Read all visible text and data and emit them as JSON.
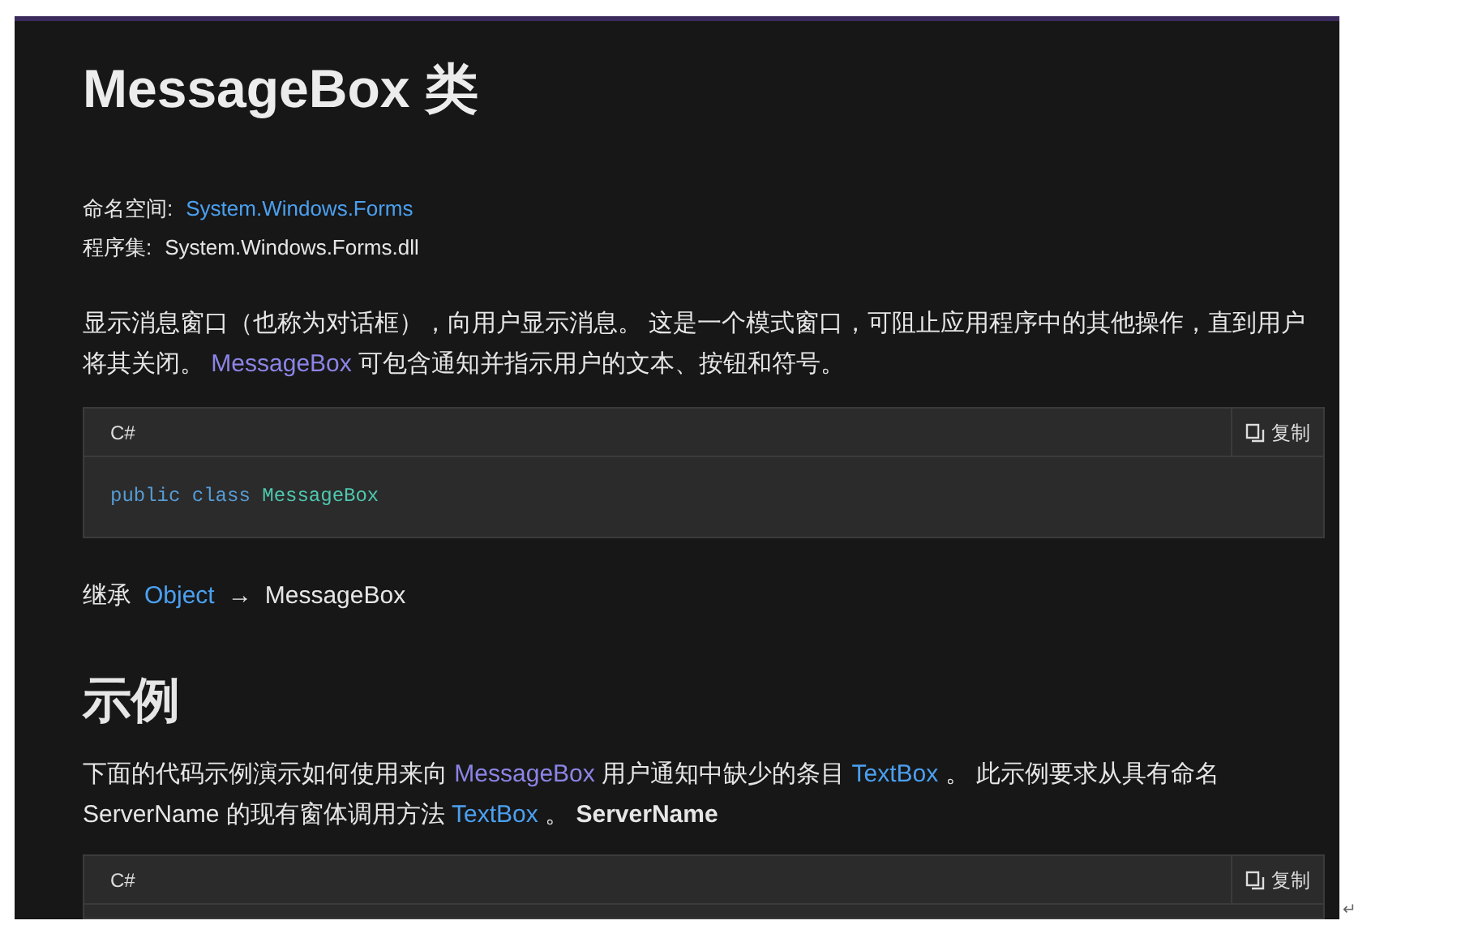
{
  "title": "MessageBox 类",
  "meta": [
    {
      "label": "命名空间:",
      "value": "System.Windows.Forms",
      "kind": "link"
    },
    {
      "label": "程序集:",
      "value": "System.Windows.Forms.dll",
      "kind": "text"
    }
  ],
  "summary": [
    {
      "kind": "text",
      "text": "显示消息窗口（也称为对话框），向用户显示消息。 这是一个模式窗口，可阻止应用程序中的其他操作，直到用户将其关闭。 "
    },
    {
      "kind": "visited",
      "text": "MessageBox"
    },
    {
      "kind": "text",
      "text": " 可包含通知并指示用户的文本、按钮和符号。"
    }
  ],
  "code_block_1": {
    "language": "C#",
    "copy": "复制",
    "code": [
      {
        "kind": "keyword",
        "text": "public class "
      },
      {
        "kind": "type",
        "text": "MessageBox"
      }
    ]
  },
  "inheritance": {
    "label": "继承",
    "items": [
      {
        "kind": "link",
        "text": "Object"
      },
      {
        "kind": "text",
        "text": "MessageBox"
      }
    ],
    "separator": "→"
  },
  "examples_heading": "示例",
  "example_text": [
    {
      "kind": "text",
      "text": "下面的代码示例演示如何使用来向 "
    },
    {
      "kind": "visited",
      "text": "MessageBox"
    },
    {
      "kind": "text",
      "text": " 用户通知中缺少的条目 "
    },
    {
      "kind": "link",
      "text": "TextBox"
    },
    {
      "kind": "text",
      "text": " 。 此示例要求从具有命名 ServerName 的现有窗体调用方法 "
    },
    {
      "kind": "link",
      "text": "TextBox"
    },
    {
      "kind": "text",
      "text": " 。 "
    },
    {
      "kind": "bold",
      "text": "ServerName"
    }
  ],
  "code_block_2": {
    "language": "C#",
    "copy": "复制"
  },
  "paragraph_mark": "↵"
}
